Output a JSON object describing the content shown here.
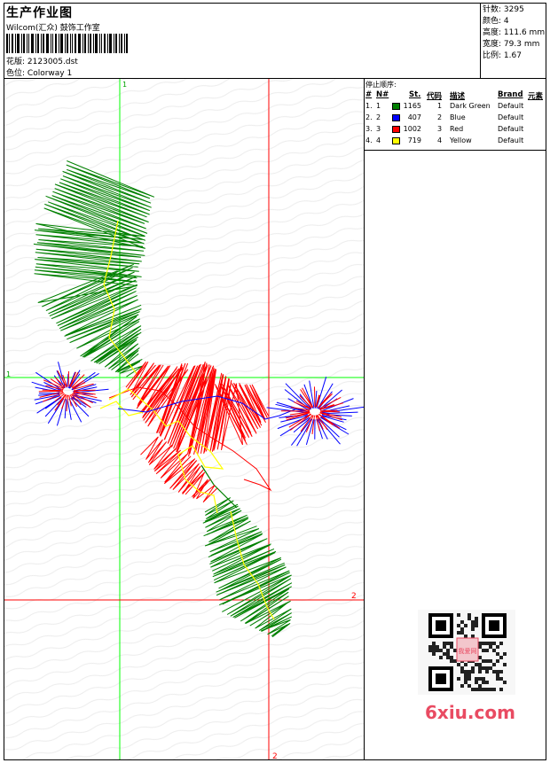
{
  "header": {
    "title": "生产作业图",
    "company": "Wilcom(汇众) 鼓饰工作室",
    "design_label": "花版:",
    "design_value": "2123005.dst",
    "colorway_label": "色位:",
    "colorway_value": "Colorway 1"
  },
  "stats": {
    "stitches_label": "针数:",
    "stitches_value": "3295",
    "colors_label": "颜色:",
    "colors_value": "4",
    "height_label": "高度:",
    "height_value": "111.6 mm",
    "width_label": "宽度:",
    "width_value": "79.3 mm",
    "ratio_label": "比例:",
    "ratio_value": "1.67"
  },
  "stop_sequence": {
    "title": "停止顺序:",
    "headers": [
      "#",
      "N#",
      "St.",
      "代码",
      "描述",
      "Brand",
      "元素"
    ],
    "rows": [
      {
        "num": "1.",
        "n": "1",
        "color": "#008000",
        "st": "1165",
        "code": "1",
        "desc": "Dark Green",
        "brand": "Default"
      },
      {
        "num": "2.",
        "n": "2",
        "color": "#0000ff",
        "st": "407",
        "code": "2",
        "desc": "Blue",
        "brand": "Default"
      },
      {
        "num": "3.",
        "n": "3",
        "color": "#ff0000",
        "st": "1002",
        "code": "3",
        "desc": "Red",
        "brand": "Default"
      },
      {
        "num": "4.",
        "n": "4",
        "color": "#ffff00",
        "st": "719",
        "code": "4",
        "desc": "Yellow",
        "brand": "Default"
      }
    ]
  },
  "guides": {
    "label_1": "1",
    "label_2": "2"
  },
  "watermark": {
    "text": "6xiu.com",
    "seal": "我爱网"
  }
}
